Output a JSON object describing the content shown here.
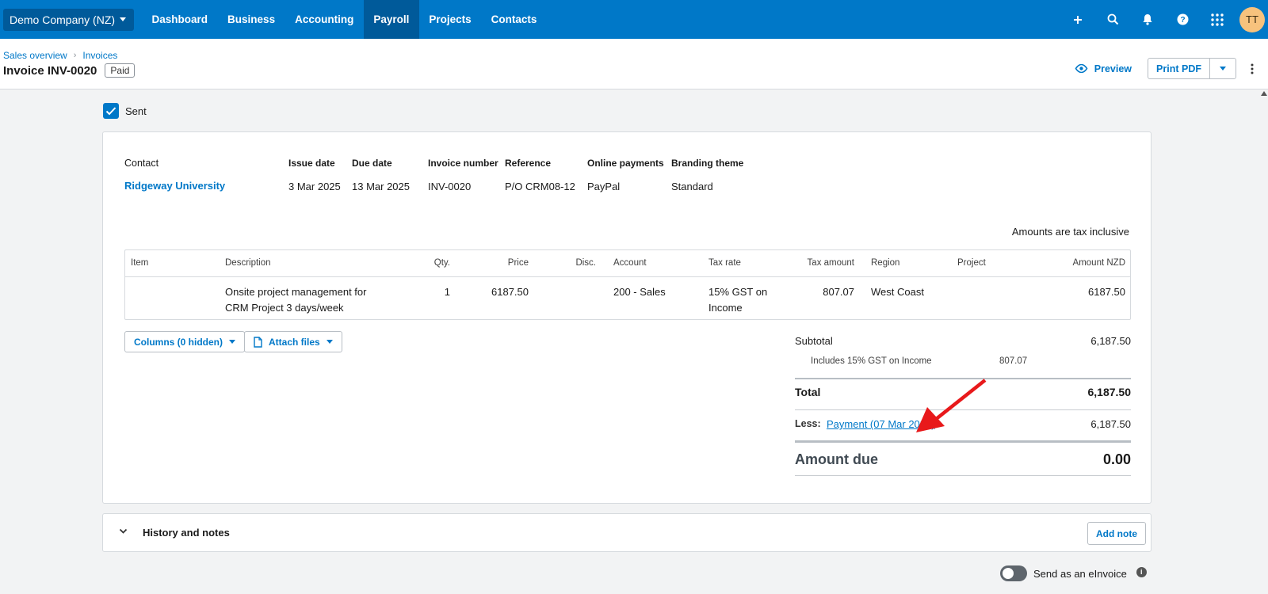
{
  "topnav": {
    "org": "Demo Company (NZ)",
    "items": [
      "Dashboard",
      "Business",
      "Accounting",
      "Payroll",
      "Projects",
      "Contacts"
    ],
    "active": "Payroll",
    "avatar_initials": "TT"
  },
  "breadcrumb": [
    "Sales overview",
    "Invoices"
  ],
  "invoice": {
    "title": "Invoice INV-0020",
    "status": "Paid",
    "preview_label": "Preview",
    "print_label": "Print PDF",
    "sent_label": "Sent"
  },
  "meta": {
    "contact_label": "Contact",
    "contact": "Ridgeway University",
    "issue_date_label": "Issue date",
    "issue_date": "3 Mar 2025",
    "due_date_label": "Due date",
    "due_date": "13 Mar 2025",
    "invoice_number_label": "Invoice number",
    "invoice_number": "INV-0020",
    "reference_label": "Reference",
    "reference": "P/O CRM08-12",
    "online_payments_label": "Online payments",
    "online_payments": "PayPal",
    "branding_label": "Branding theme",
    "branding": "Standard"
  },
  "tax_note": "Amounts are tax inclusive",
  "table": {
    "headers": {
      "item": "Item",
      "description": "Description",
      "qty": "Qty.",
      "price": "Price",
      "disc": "Disc.",
      "account": "Account",
      "tax_rate": "Tax rate",
      "tax_amount": "Tax amount",
      "region": "Region",
      "project": "Project",
      "amount": "Amount NZD"
    },
    "row": {
      "item": "",
      "description_1": "Onsite project management for",
      "description_2": "CRM Project 3 days/week",
      "qty": "1",
      "price": "6187.50",
      "disc": "",
      "account": "200 - Sales",
      "tax_rate_1": "15% GST on",
      "tax_rate_2": "Income",
      "tax_amount": "807.07",
      "region": "West Coast",
      "project": "",
      "amount": "6187.50"
    }
  },
  "buttons": {
    "columns": "Columns (0 hidden)",
    "attach": "Attach files"
  },
  "totals": {
    "subtotal_label": "Subtotal",
    "subtotal": "6,187.50",
    "includes_label": "Includes 15% GST on Income",
    "includes_value": "807.07",
    "total_label": "Total",
    "total": "6,187.50",
    "less_label": "Less:",
    "payment_link": "Payment (07 Mar 2025)",
    "payment_amount": "6,187.50",
    "amount_due_label": "Amount due",
    "amount_due": "0.00"
  },
  "history": {
    "title": "History and notes",
    "add_note": "Add note"
  },
  "einvoice_label": "Send as an eInvoice",
  "colors": {
    "brand": "#0078c8",
    "nav_active": "#005a9a",
    "annotation_arrow": "#e8191b"
  }
}
